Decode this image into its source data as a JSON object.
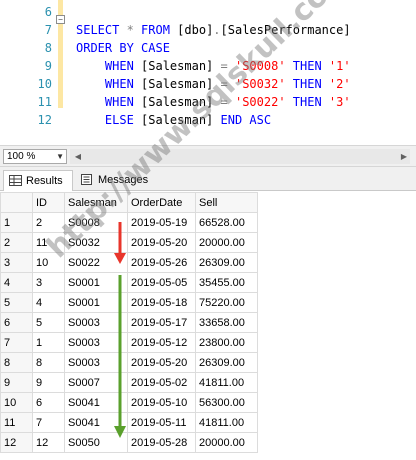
{
  "editor": {
    "lines": [
      {
        "num": "6",
        "tokens": []
      },
      {
        "num": "7",
        "tokens": [
          {
            "t": "SELECT ",
            "c": "kw"
          },
          {
            "t": "*",
            "c": "op"
          },
          {
            "t": " FROM ",
            "c": "kw"
          },
          {
            "t": "[dbo]",
            "c": "plain"
          },
          {
            "t": ".",
            "c": "op"
          },
          {
            "t": "[SalesPerformance]",
            "c": "plain"
          }
        ]
      },
      {
        "num": "8",
        "tokens": [
          {
            "t": "ORDER BY CASE",
            "c": "kw"
          }
        ]
      },
      {
        "num": "9",
        "tokens": [
          {
            "t": "    WHEN ",
            "c": "kw"
          },
          {
            "t": "[Salesman] ",
            "c": "plain"
          },
          {
            "t": "=",
            "c": "op"
          },
          {
            "t": " 'S0008'",
            "c": "str"
          },
          {
            "t": " THEN ",
            "c": "kw"
          },
          {
            "t": "'1'",
            "c": "str"
          }
        ]
      },
      {
        "num": "10",
        "tokens": [
          {
            "t": "    WHEN ",
            "c": "kw"
          },
          {
            "t": "[Salesman] ",
            "c": "plain"
          },
          {
            "t": "=",
            "c": "op"
          },
          {
            "t": " 'S0032'",
            "c": "str"
          },
          {
            "t": " THEN ",
            "c": "kw"
          },
          {
            "t": "'2'",
            "c": "str"
          }
        ]
      },
      {
        "num": "11",
        "tokens": [
          {
            "t": "    WHEN ",
            "c": "kw"
          },
          {
            "t": "[Salesman] ",
            "c": "plain"
          },
          {
            "t": "=",
            "c": "op"
          },
          {
            "t": " 'S0022'",
            "c": "str"
          },
          {
            "t": " THEN ",
            "c": "kw"
          },
          {
            "t": "'3'",
            "c": "str"
          }
        ]
      },
      {
        "num": "12",
        "tokens": [
          {
            "t": "    ELSE ",
            "c": "kw"
          },
          {
            "t": "[Salesman] ",
            "c": "plain"
          },
          {
            "t": "END ASC",
            "c": "kw"
          }
        ]
      }
    ]
  },
  "zoom": {
    "value": "100 %"
  },
  "tabs": {
    "results": "Results",
    "messages": "Messages"
  },
  "grid": {
    "columns": [
      "ID",
      "Salesman",
      "OrderDate",
      "Sell"
    ],
    "rows": [
      {
        "n": "1",
        "cells": [
          "2",
          "S0008",
          "2019-05-19",
          "66528.00"
        ]
      },
      {
        "n": "2",
        "cells": [
          "11",
          "S0032",
          "2019-05-20",
          "20000.00"
        ]
      },
      {
        "n": "3",
        "cells": [
          "10",
          "S0022",
          "2019-05-26",
          "26309.00"
        ]
      },
      {
        "n": "4",
        "cells": [
          "3",
          "S0001",
          "2019-05-05",
          "35455.00"
        ]
      },
      {
        "n": "5",
        "cells": [
          "4",
          "S0001",
          "2019-05-18",
          "75220.00"
        ]
      },
      {
        "n": "6",
        "cells": [
          "5",
          "S0003",
          "2019-05-17",
          "33658.00"
        ]
      },
      {
        "n": "7",
        "cells": [
          "1",
          "S0003",
          "2019-05-12",
          "23800.00"
        ]
      },
      {
        "n": "8",
        "cells": [
          "8",
          "S0003",
          "2019-05-20",
          "26309.00"
        ]
      },
      {
        "n": "9",
        "cells": [
          "9",
          "S0007",
          "2019-05-02",
          "41811.00"
        ]
      },
      {
        "n": "10",
        "cells": [
          "6",
          "S0041",
          "2019-05-10",
          "56300.00"
        ]
      },
      {
        "n": "11",
        "cells": [
          "7",
          "S0041",
          "2019-05-11",
          "41811.00"
        ]
      },
      {
        "n": "12",
        "cells": [
          "12",
          "S0050",
          "2019-05-28",
          "20000.00"
        ]
      }
    ]
  },
  "watermark": "http://www.sqlskull.com",
  "colors": {
    "arrow_red": "#e8352b",
    "arrow_green": "#5aa02c",
    "keyword": "#0000ff",
    "string": "#ff0000",
    "line_number": "#2b91af"
  }
}
